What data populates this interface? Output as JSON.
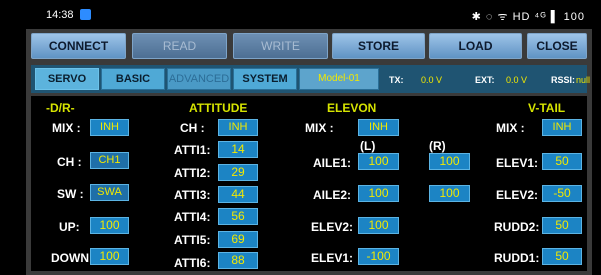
{
  "status_bar": {
    "time": "14:38",
    "indicators": "✱ ◌ ᯤ HD ⁴ᴳ ▌ 100"
  },
  "toolbar": {
    "connect": "CONNECT",
    "read": "READ",
    "write": "WRITE",
    "store": "STORE",
    "load": "LOAD",
    "close": "CLOSE"
  },
  "tabs": {
    "servo": "SERVO",
    "basic": "BASIC",
    "advanced": "ADVANCED",
    "system": "SYSTEM",
    "model": "Model-01"
  },
  "telemetry": {
    "tx_label": "TX:",
    "tx_value": "0.0 V",
    "ext_label": "EXT:",
    "ext_value": "0.0 V",
    "rssi_label": "RSSI:",
    "rssi_value": "null"
  },
  "dr": {
    "header": "-D/R-",
    "mix_label": "MIX :",
    "mix_value": "INH",
    "ch_label": "CH :",
    "ch_value": "CH1",
    "sw_label": "SW :",
    "sw_value": "SWA",
    "up_label": "UP:",
    "up_value": "100",
    "down_label": "DOWN:",
    "down_value": "100"
  },
  "attitude": {
    "header": "ATTITUDE",
    "ch_label": "CH :",
    "ch_value": "INH",
    "items": [
      {
        "label": "ATTI1:",
        "value": "14"
      },
      {
        "label": "ATTI2:",
        "value": "29"
      },
      {
        "label": "ATTI3:",
        "value": "44"
      },
      {
        "label": "ATTI4:",
        "value": "56"
      },
      {
        "label": "ATTI5:",
        "value": "69"
      },
      {
        "label": "ATTI6:",
        "value": "88"
      }
    ]
  },
  "elevon": {
    "header": "ELEVON",
    "mix_label": "MIX :",
    "mix_value": "INH",
    "left_label": "(L)",
    "right_label": "(R)",
    "aile1_label": "AILE1:",
    "aile1_l": "100",
    "aile1_r": "100",
    "aile2_label": "AILE2:",
    "aile2_l": "100",
    "aile2_r": "100",
    "elev2_label": "ELEV2:",
    "elev2_l": "100",
    "elev1_label": "ELEV1:",
    "elev1_l": "-100"
  },
  "vtail": {
    "header": "V-TAIL",
    "mix_label": "MIX :",
    "mix_value": "INH",
    "elev1_label": "ELEV1:",
    "elev1_value": "50",
    "elev2_label": "ELEV2:",
    "elev2_value": "-50",
    "rudd2_label": "RUDD2:",
    "rudd2_value": "50",
    "rudd1_label": "RUDD1:",
    "rudd1_value": "50"
  }
}
